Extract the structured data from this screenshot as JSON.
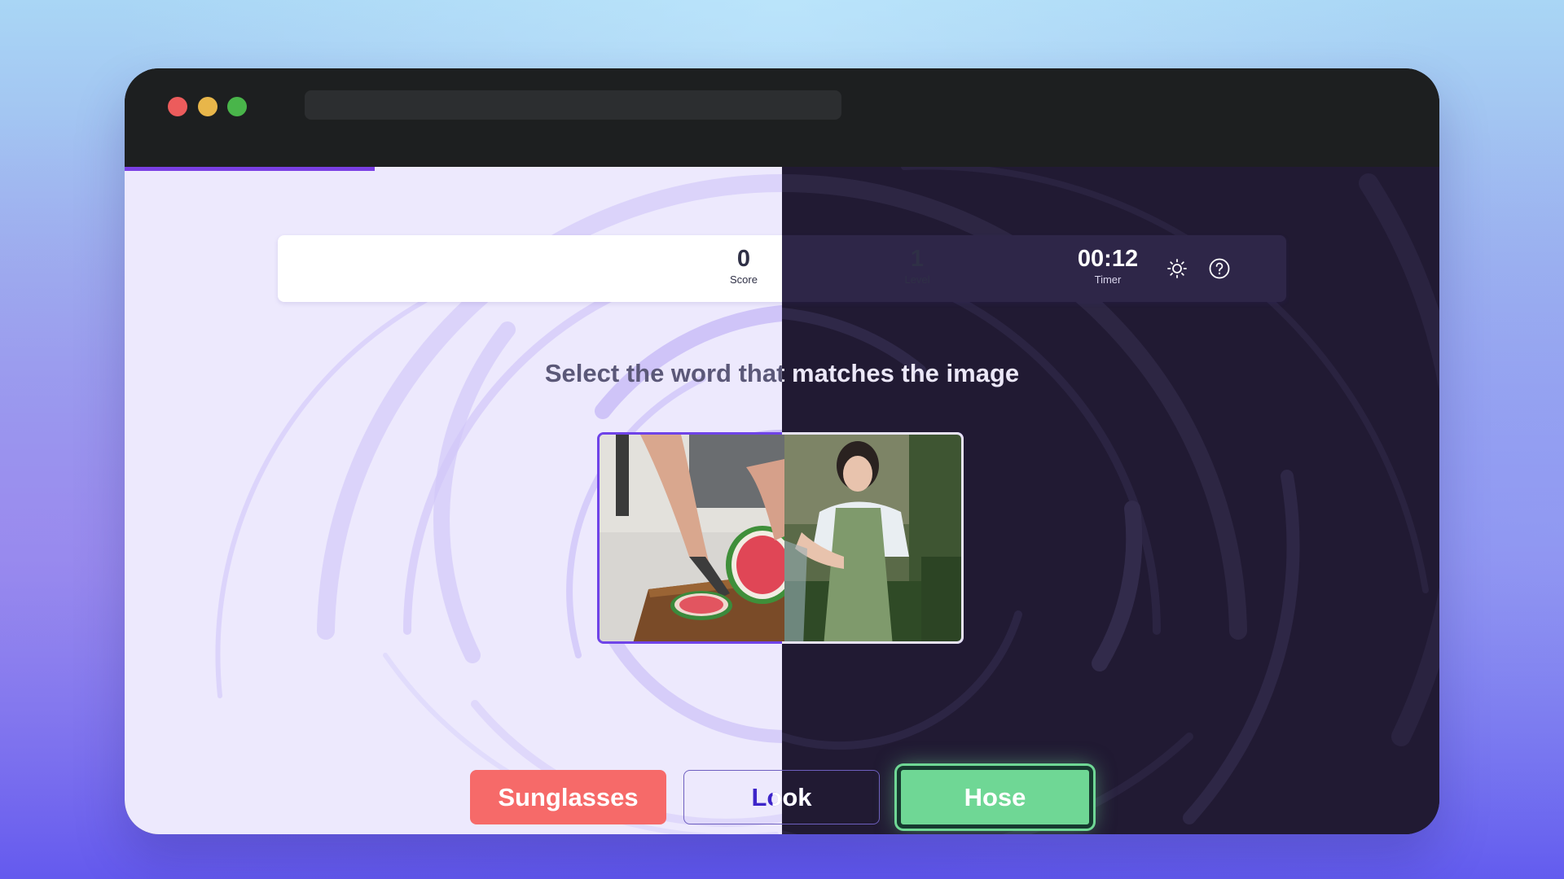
{
  "window": {
    "traffic_lights": [
      "#ec5c5c",
      "#e8b64a",
      "#49b54a"
    ],
    "url": ""
  },
  "progress": {
    "fraction": 0.19,
    "color": "#7a3fe4"
  },
  "stats": {
    "score": {
      "value": "0",
      "label": "Score"
    },
    "level": {
      "value": "1",
      "label": "Level"
    },
    "timer": {
      "value": "00:12",
      "label": "Timer"
    }
  },
  "icons": {
    "theme": "sun-icon",
    "help": "question-circle-icon"
  },
  "instruction": "Select the word that matches the image",
  "image": {
    "left_scene": "cutting watermelon",
    "right_scene": "woman watering plants with hose"
  },
  "answers": [
    {
      "label": "Sunglasses",
      "state": "wrong",
      "color": "#f66a69"
    },
    {
      "label": "Look",
      "state": "neutral",
      "color": "#3d24c9"
    },
    {
      "label": "Hose",
      "state": "correct",
      "color": "#6fd795"
    }
  ],
  "theme": {
    "light_bg": "#ede9fd",
    "dark_bg": "#211a33",
    "accent": "#6f43e8"
  }
}
